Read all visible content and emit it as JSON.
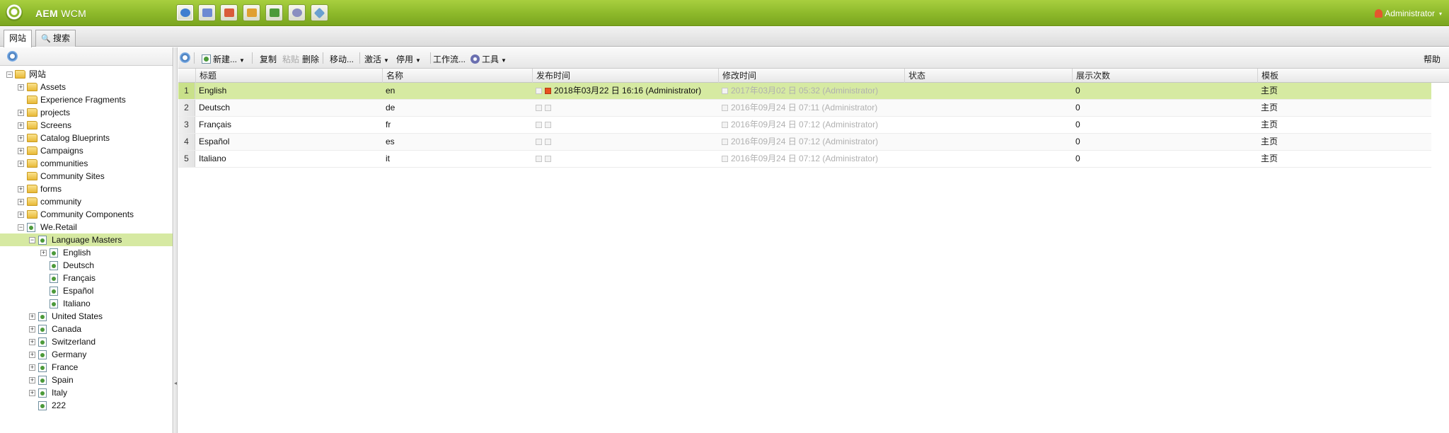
{
  "app": {
    "title_bold": "AEM",
    "title_rest": " WCM",
    "user": "Administrator",
    "console_icons": [
      {
        "name": "websites-console-icon",
        "color": "#3f7fd0"
      },
      {
        "name": "digital-assets-console-icon",
        "color": "#6d8ad2"
      },
      {
        "name": "campaigns-console-icon",
        "color": "#d95b3a"
      },
      {
        "name": "inbox-console-icon",
        "color": "#e0a030"
      },
      {
        "name": "users-console-icon",
        "color": "#4c9a3a"
      },
      {
        "name": "tools-console-icon",
        "color": "#8a8fc0"
      },
      {
        "name": "tagging-console-icon",
        "color": "#6aa0d0"
      }
    ]
  },
  "tabs": [
    {
      "label": "网站"
    },
    {
      "label": "搜索"
    }
  ],
  "tree": {
    "root": "网站",
    "nodes": [
      {
        "label": "Assets"
      },
      {
        "label": "Experience Fragments"
      },
      {
        "label": "projects"
      },
      {
        "label": "Screens"
      },
      {
        "label": "Catalog Blueprints"
      },
      {
        "label": "Campaigns"
      },
      {
        "label": "communities"
      },
      {
        "label": "Community Sites"
      },
      {
        "label": "forms"
      },
      {
        "label": "community"
      },
      {
        "label": "Community Components"
      },
      {
        "label": "We.Retail"
      },
      {
        "label": "Language Masters"
      },
      {
        "label": "English"
      },
      {
        "label": "Deutsch"
      },
      {
        "label": "Français"
      },
      {
        "label": "Español"
      },
      {
        "label": "Italiano"
      },
      {
        "label": "United States"
      },
      {
        "label": "Canada"
      },
      {
        "label": "Switzerland"
      },
      {
        "label": "Germany"
      },
      {
        "label": "France"
      },
      {
        "label": "Spain"
      },
      {
        "label": "Italy"
      },
      {
        "label": "222"
      }
    ]
  },
  "toolbar": {
    "new": "新建...",
    "copy": "复制",
    "paste": "粘贴",
    "delete": "删除",
    "move": "移动...",
    "activate": "激活",
    "deactivate": "停用",
    "workflow": "工作流...",
    "tools": "工具",
    "help": "帮助"
  },
  "grid": {
    "columns": [
      "标题",
      "名称",
      "发布时间",
      "修改时间",
      "状态",
      "展示次数",
      "模板"
    ],
    "rows": [
      {
        "num": "1",
        "title": "English",
        "name": "en",
        "published": "2018年03月22 日 16:16 (Administrator)",
        "modified": "2017年03月02 日 05:32 (Administrator)",
        "status": "",
        "impressions": "0",
        "template": "主页"
      },
      {
        "num": "2",
        "title": "Deutsch",
        "name": "de",
        "published": "",
        "modified": "2016年09月24 日 07:11 (Administrator)",
        "status": "",
        "impressions": "0",
        "template": "主页"
      },
      {
        "num": "3",
        "title": "Français",
        "name": "fr",
        "published": "",
        "modified": "2016年09月24 日 07:12 (Administrator)",
        "status": "",
        "impressions": "0",
        "template": "主页"
      },
      {
        "num": "4",
        "title": "Español",
        "name": "es",
        "published": "",
        "modified": "2016年09月24 日 07:12 (Administrator)",
        "status": "",
        "impressions": "0",
        "template": "主页"
      },
      {
        "num": "5",
        "title": "Italiano",
        "name": "it",
        "published": "",
        "modified": "2016年09月24 日 07:12 (Administrator)",
        "status": "",
        "impressions": "0",
        "template": "主页"
      }
    ]
  },
  "colors": {
    "topbar": "#8cb82a",
    "selection": "#d6eaa2",
    "muted_text": "#b0b0b0"
  }
}
